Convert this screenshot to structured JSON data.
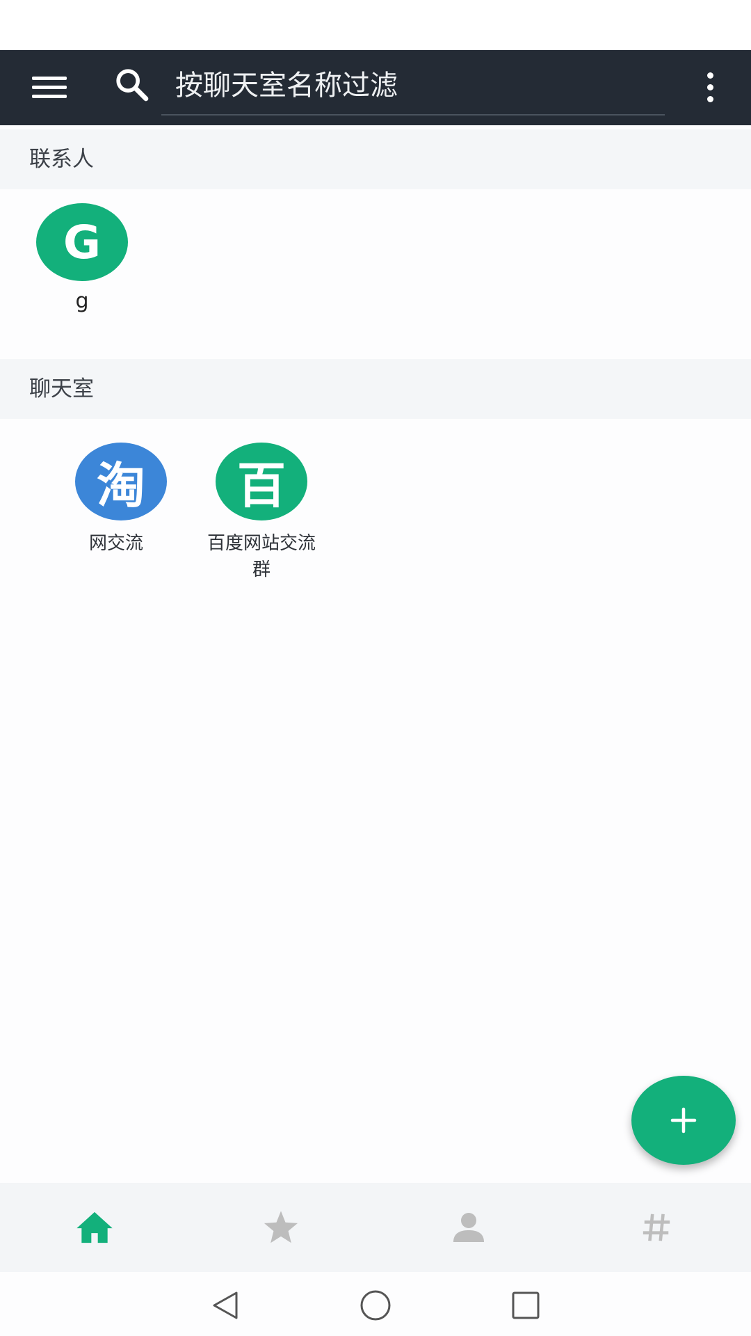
{
  "app_bar": {
    "search_placeholder": "按聊天室名称过滤",
    "background_color": "#242b35",
    "icons": [
      "menu-icon",
      "search-icon",
      "more-vert-icon"
    ]
  },
  "contacts_section": {
    "title": "联系人",
    "items": [
      {
        "avatar_text": "G",
        "label": "g",
        "avatar_color": "#13b07b"
      }
    ]
  },
  "rooms_section": {
    "title": "聊天室",
    "items": [
      {
        "avatar_text": "淘",
        "label": "网交流",
        "avatar_color": "#3c86d8"
      },
      {
        "avatar_text": "百",
        "label_line1": "百度网站交流",
        "label_line2": "群",
        "avatar_color": "#13b07b"
      }
    ]
  },
  "fab": {
    "icon": "plus-icon",
    "color": "#13b07b"
  },
  "bottom_nav": {
    "items": [
      {
        "icon": "home-icon",
        "active": true
      },
      {
        "icon": "star-icon",
        "active": false
      },
      {
        "icon": "person-icon",
        "active": false
      },
      {
        "icon": "hash-icon",
        "active": false
      }
    ],
    "active_color": "#13b07b",
    "inactive_color": "#bdbdbd"
  },
  "system_nav": {
    "icons": [
      "back-icon",
      "home-circle-icon",
      "recents-icon"
    ]
  }
}
